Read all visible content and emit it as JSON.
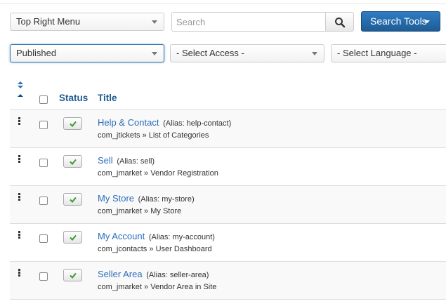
{
  "filters": {
    "menu_select": "Top Right Menu",
    "search_placeholder": "Search",
    "search_tools_label": "Search Tools",
    "status_select": "Published",
    "access_select": "- Select Access -",
    "language_select": "- Select Language -"
  },
  "table": {
    "header_status": "Status",
    "header_title": "Title",
    "rows": [
      {
        "title": "Help & Contact",
        "alias": "(Alias: help-contact)",
        "component": "com_jtickets",
        "view": "List of Categories"
      },
      {
        "title": "Sell",
        "alias": "(Alias: sell)",
        "component": "com_jmarket",
        "view": "Vendor Registration"
      },
      {
        "title": "My Store",
        "alias": "(Alias: my-store)",
        "component": "com_jmarket",
        "view": "My Store"
      },
      {
        "title": "My Account",
        "alias": "(Alias: my-account)",
        "component": "com_jcontacts",
        "view": "User Dashboard"
      },
      {
        "title": "Seller Area",
        "alias": "(Alias: seller-area)",
        "component": "com_jmarket",
        "view": "Vendor Area in Site"
      }
    ],
    "separator": "»"
  },
  "icons": {
    "search": "search-icon",
    "sort": "sort-icon",
    "drag": "drag-handle-icon",
    "published": "check-icon"
  },
  "colors": {
    "primary_button": "#2a6ebb",
    "link": "#2a6ebb",
    "header_text": "#1f5c91",
    "check": "#3a9a2e"
  }
}
